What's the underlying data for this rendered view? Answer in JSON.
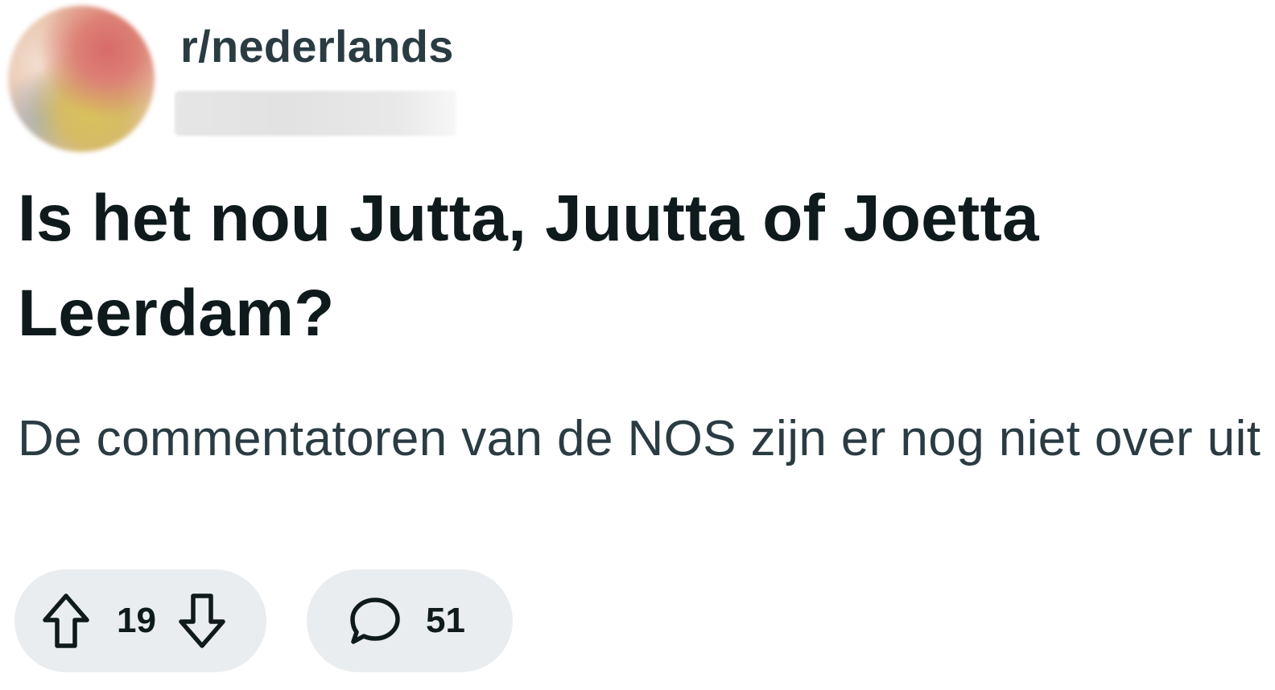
{
  "post": {
    "subreddit": "r/nederlands",
    "title": "Is het nou Jutta, Juutta of Joetta Leerdam?",
    "body": "De commentatoren van de NOS zijn er nog niet over uit"
  },
  "actions": {
    "vote_count": "19",
    "comment_count": "51"
  },
  "icons": {
    "upvote": "arrow-up-icon",
    "downvote": "arrow-down-icon",
    "comments": "speech-bubble-icon"
  },
  "colors": {
    "background": "#ffffff",
    "title_text": "#0f1a1c",
    "secondary_text": "#2a3c42",
    "pill_background": "#eaedef"
  }
}
